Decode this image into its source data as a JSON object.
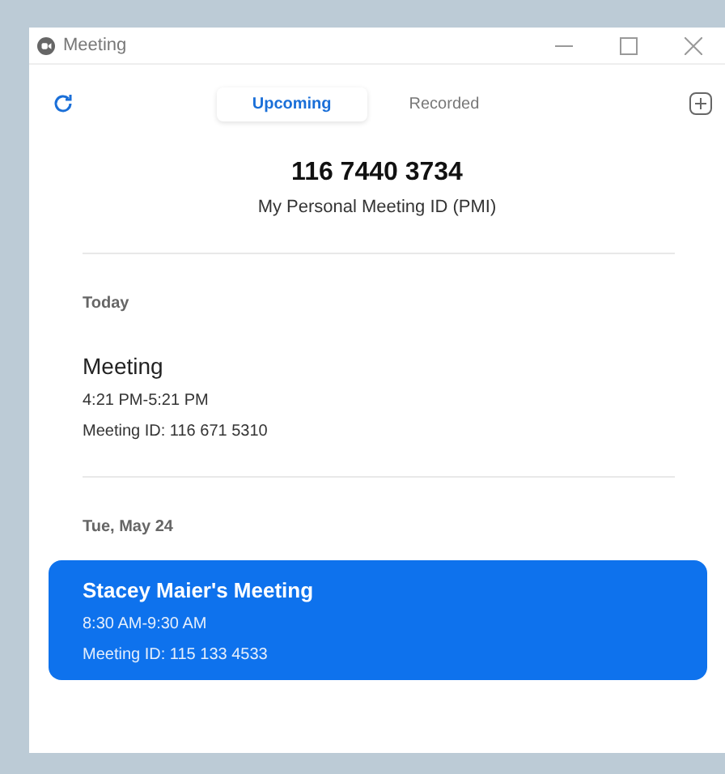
{
  "window": {
    "title": "Meeting"
  },
  "tabs": [
    {
      "label": "Upcoming",
      "selected": true
    },
    {
      "label": "Recorded",
      "selected": false
    }
  ],
  "pmi": {
    "number": "116 7440 3734",
    "label": "My Personal Meeting ID (PMI)"
  },
  "groups": [
    {
      "heading": "Today",
      "meetings": [
        {
          "title": "Meeting",
          "time": "4:21 PM-5:21 PM",
          "meeting_id": "Meeting ID: 116 671 5310",
          "selected": false
        }
      ]
    },
    {
      "heading": "Tue, May 24",
      "meetings": [
        {
          "title": "Stacey Maier's Meeting",
          "time": "8:30 AM-9:30 AM",
          "meeting_id": "Meeting ID: 115 133 4533",
          "selected": true
        }
      ]
    }
  ]
}
